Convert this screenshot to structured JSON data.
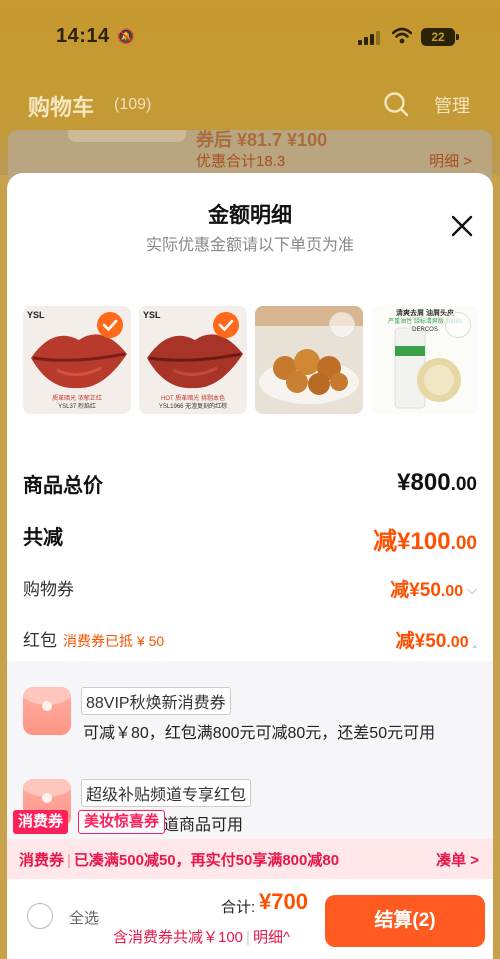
{
  "status_bar": {
    "time": "14:14",
    "battery": "22"
  },
  "header": {
    "title": "购物车",
    "count": "(109)",
    "manage_label": "管理"
  },
  "background_item": {
    "price_line": "券后 ¥81.7 ¥100",
    "promo_total": "优惠合计18.3",
    "detail_link": "明细 >"
  },
  "sheet": {
    "title": "金额明细",
    "subtitle": "实际优惠金额请以下单页为准",
    "products": [
      {
        "name": "YSL37 烈焰红",
        "tag": "质革暗光 浓郁正红",
        "brand": "YSL",
        "selected": true
      },
      {
        "name": "YSL1966 无渣复刻的红棕",
        "tag": "HOT 质革暗光 挑剔本色",
        "brand": "YSL",
        "selected": true
      },
      {
        "name": "",
        "tag": "",
        "brand": "",
        "selected": false
      },
      {
        "name": "清爽去屑 油屑头皮",
        "tag": "严重油性 绿标清爽版 200ml",
        "brand": "DERCOS",
        "selected": false
      }
    ],
    "total_label": "商品总价",
    "total_prefix": "¥",
    "total_int": "800",
    "total_dec": ".00",
    "reduce_label": "共减",
    "reduce_prefix": "减¥",
    "reduce_int": "100",
    "reduce_dec": ".00",
    "voucher_label": "购物券",
    "voucher_prefix": "减¥",
    "voucher_int": "50",
    "voucher_dec": ".00",
    "redpacket_label": "红包",
    "redpacket_note": "消费券已抵 ¥ 50",
    "redpacket_prefix": "减¥",
    "redpacket_int": "50",
    "redpacket_dec": ".00",
    "coupons": [
      {
        "title": "88VIP秋焕新消费券",
        "desc": "可减￥80，红包满800元可减80元，还差50元可用"
      },
      {
        "title": "超级补贴频道专享红包",
        "desc": "超级补贴频道商品可用"
      }
    ]
  },
  "chips": {
    "consume": "消费券",
    "beauty": "美妆惊喜券"
  },
  "promo_bar": {
    "label": "消费券",
    "text": "已凑满500减50，再实付50享满800减80",
    "action": "凑单 >"
  },
  "bottom": {
    "select_all": "全选",
    "sum_label": "合计:",
    "sum_value": "¥700",
    "note": "含消费券共减￥100",
    "detail": "明细^",
    "checkout": "结算(2)"
  },
  "colors": {
    "accent": "#ff5000",
    "promo_pink": "#e8174a",
    "header_gold": "#c7992f"
  }
}
